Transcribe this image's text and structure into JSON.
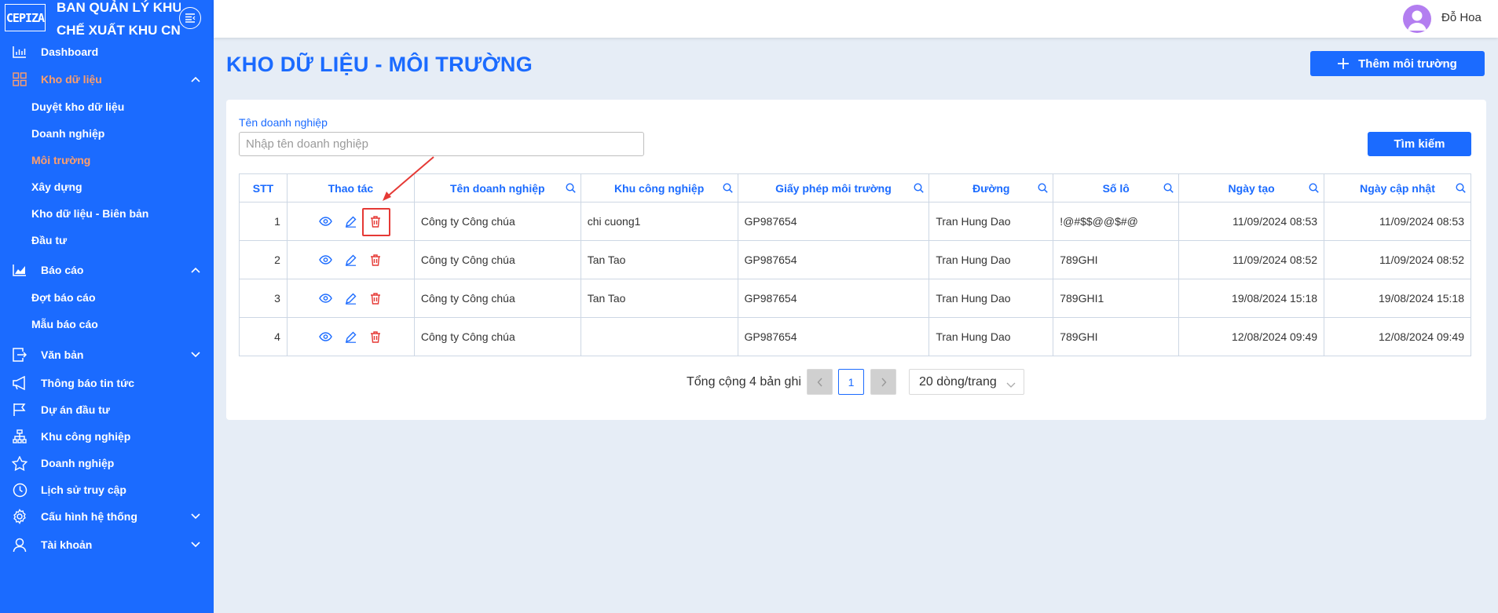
{
  "brand": {
    "logo_text": "CEPIZA",
    "line1": "BAN QUẢN LÝ KHU",
    "line2": "CHẾ XUẤT KHU CN"
  },
  "sidebar": {
    "items": [
      {
        "label": "Dashboard",
        "icon": "bar-chart-icon"
      },
      {
        "label": "Kho dữ liệu",
        "icon": "grid-icon",
        "active": true,
        "expanded": true,
        "children": [
          "Duyệt kho dữ liệu",
          "Doanh nghiệp",
          "Môi trường",
          "Xây dựng",
          "Kho dữ liệu - Biên bản",
          "Đầu tư"
        ],
        "active_child": "Môi trường"
      },
      {
        "label": "Báo cáo",
        "icon": "area-chart-icon",
        "expanded": true,
        "children": [
          "Đợt báo cáo",
          "Mẫu báo cáo"
        ]
      },
      {
        "label": "Văn bản",
        "icon": "export-icon"
      },
      {
        "label": "Thông báo tin tức",
        "icon": "megaphone-icon"
      },
      {
        "label": "Dự án đầu tư",
        "icon": "flag-icon"
      },
      {
        "label": "Khu công nghiệp",
        "icon": "cluster-icon"
      },
      {
        "label": "Doanh nghiệp",
        "icon": "star-icon"
      },
      {
        "label": "Lịch sử truy cập",
        "icon": "clock-icon"
      },
      {
        "label": "Cấu hình hệ thống",
        "icon": "gear-icon"
      },
      {
        "label": "Tài khoản",
        "icon": "user-icon"
      }
    ]
  },
  "header": {
    "user_name": "Đỗ Hoa"
  },
  "page": {
    "title": "KHO DỮ LIỆU - MÔI TRƯỜNG",
    "add_button": "Thêm môi trường"
  },
  "filter": {
    "label": "Tên doanh nghiệp",
    "placeholder": "Nhập tên doanh nghiệp",
    "search_button": "Tìm kiếm"
  },
  "table": {
    "columns": [
      "STT",
      "Thao tác",
      "Tên doanh nghiệp",
      "Khu công nghiệp",
      "Giấy phép môi trường",
      "Đường",
      "Số lô",
      "Ngày tạo",
      "Ngày cập nhật"
    ],
    "rows": [
      {
        "stt": "1",
        "company": "Công ty Công chúa",
        "park": "chi cuong1",
        "permit": "GP987654",
        "street": "Tran Hung Dao",
        "lot": "!@#$$@@$#@",
        "created": "11/09/2024 08:53",
        "updated": "11/09/2024 08:53"
      },
      {
        "stt": "2",
        "company": "Công ty Công chúa",
        "park": "Tan Tao",
        "permit": "GP987654",
        "street": "Tran Hung Dao",
        "lot": "789GHI",
        "created": "11/09/2024 08:52",
        "updated": "11/09/2024 08:52"
      },
      {
        "stt": "3",
        "company": "Công ty Công chúa",
        "park": "Tan Tao",
        "permit": "GP987654",
        "street": "Tran Hung Dao",
        "lot": "789GHI1",
        "created": "19/08/2024 15:18",
        "updated": "19/08/2024 15:18"
      },
      {
        "stt": "4",
        "company": "Công ty Công chúa",
        "park": "",
        "permit": "GP987654",
        "street": "Tran Hung Dao",
        "lot": "789GHI",
        "created": "12/08/2024 09:49",
        "updated": "12/08/2024 09:49"
      }
    ]
  },
  "pagination": {
    "total_text": "Tổng cộng 4 bản ghi",
    "current_page": "1",
    "page_size": "20 dòng/trang"
  },
  "colors": {
    "primary": "#1b6bff",
    "active_nav": "#ff9e6b",
    "delete": "#e53935",
    "background": "#e6edf6"
  }
}
